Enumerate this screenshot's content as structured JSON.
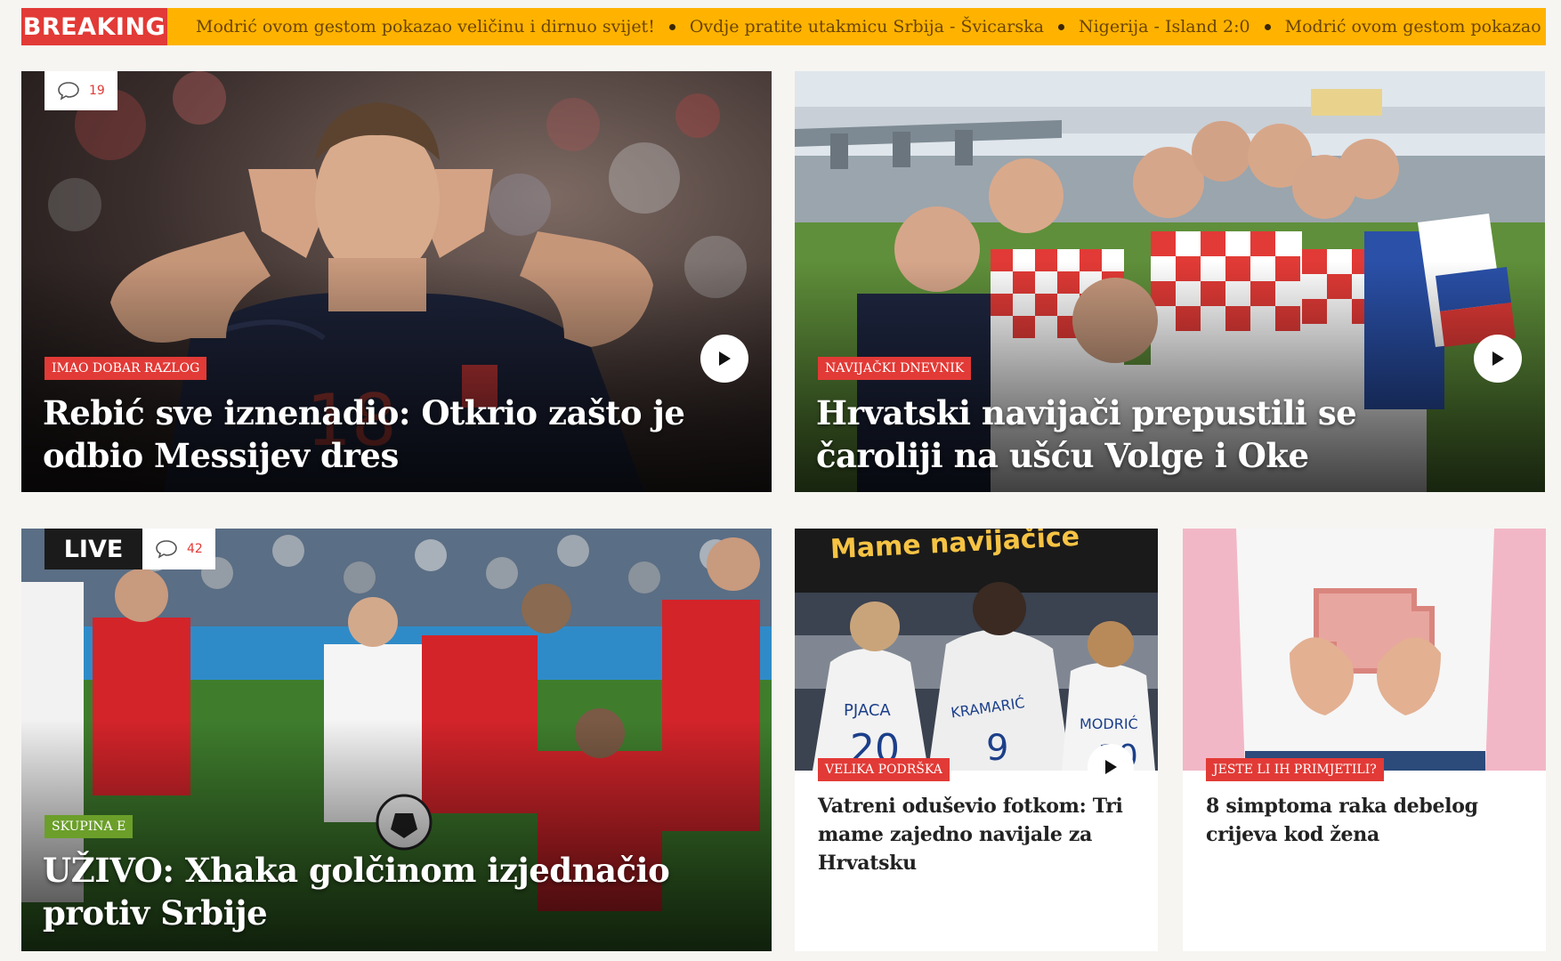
{
  "breaking": {
    "label": "BREAKING",
    "items": [
      "Modrić ovom gestom pokazao veličinu i dirnuo svijet!",
      "Ovdje pratite utakmicu Srbija - Švicarska",
      "Nigerija - Island 2:0",
      "Modrić ovom gestom pokazao veliči"
    ]
  },
  "cards": {
    "rebic": {
      "comments": "19",
      "kicker": "IMAO DOBAR RAZLOG",
      "title_line1": "Rebić sve iznenadio: Otkrio zašto je",
      "title_line2": "odbio Messijev dres"
    },
    "fans": {
      "kicker": "NAVIJAČKI DNEVNIK",
      "title_line1": "Hrvatski navijači prepustili se",
      "title_line2": "čaroliji na ušću Volge i Oke"
    },
    "live": {
      "badge": "LIVE",
      "comments": "42",
      "kicker": "SKUPINA E",
      "title_line1": "UŽIVO: Xhaka golčinom izjednačio",
      "title_line2": "protiv Srbije"
    },
    "moms": {
      "image_banner": "Mame navijačice",
      "jersey1": "PJACA",
      "jersey2": "KRAMARIĆ",
      "jersey3": "MODRIĆ",
      "kicker": "VELIKA PODRŠKA",
      "title": "Vatreni oduševio fotkom: Tri mame zajedno navijale za Hrvatsku"
    },
    "health": {
      "kicker": "JESTE LI IH PRIMJETILI?",
      "title": "8 simptoma raka debelog crijeva kod žena"
    }
  },
  "colors": {
    "ticker_bg": "#ffb300",
    "accent_red": "#e23a36",
    "group_green": "#6b9f2a"
  },
  "icons": [
    "comment-bubble-icon",
    "play-icon"
  ]
}
